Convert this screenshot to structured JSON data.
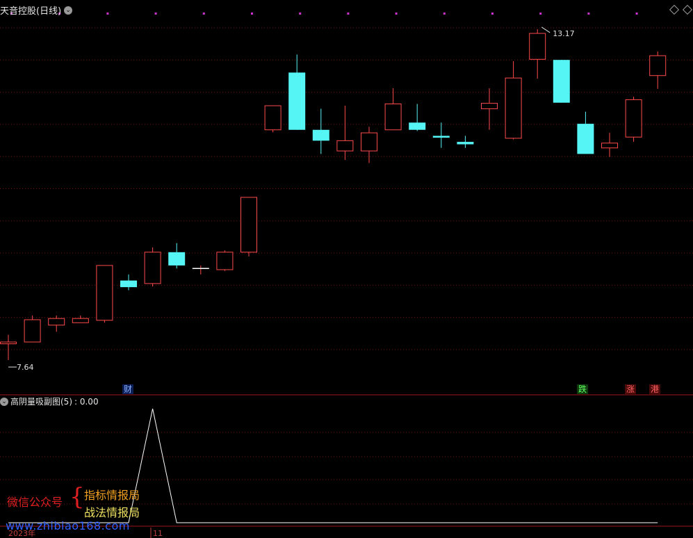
{
  "header": {
    "title": "天音控股(日线)",
    "menu_icon": "chevron-down-icon"
  },
  "subchart": {
    "title": "高阴量吸副图(5)",
    "value_text": ": 0.00"
  },
  "price_labels": {
    "high": "13.17",
    "low": "7.64"
  },
  "event_badges": [
    {
      "text": "财",
      "color": "#4a8aff"
    },
    {
      "text": "跌",
      "color": "#40d040"
    },
    {
      "text": "涨",
      "color": "#ff4040"
    },
    {
      "text": "港",
      "color": "#ff4040"
    }
  ],
  "time_axis": {
    "year_label": "2023年",
    "month_label": "11"
  },
  "watermark": {
    "left": "微信公众号",
    "right_1": "指标情报局",
    "right_2": "战法情报局",
    "url": "www.zhibiao168.com"
  },
  "colors": {
    "up": "#ff4a4a",
    "down": "#55f5f5",
    "grid": "#7a1010",
    "marker": "#cc33cc",
    "indicator": "#ffffff"
  },
  "chart_data": {
    "type": "candlestick",
    "price_range": [
      7.3,
      13.4
    ],
    "candles": [
      {
        "o": 7.95,
        "h": 8.1,
        "l": 7.68,
        "c": 7.98
      },
      {
        "o": 7.98,
        "h": 8.42,
        "l": 7.98,
        "c": 8.35
      },
      {
        "o": 8.26,
        "h": 8.42,
        "l": 8.15,
        "c": 8.37
      },
      {
        "o": 8.3,
        "h": 8.42,
        "l": 8.3,
        "c": 8.37
      },
      {
        "o": 8.34,
        "h": 9.25,
        "l": 8.3,
        "c": 9.25
      },
      {
        "o": 9.0,
        "h": 9.1,
        "l": 8.84,
        "c": 8.89
      },
      {
        "o": 8.95,
        "h": 9.55,
        "l": 8.9,
        "c": 9.47
      },
      {
        "o": 9.47,
        "h": 9.62,
        "l": 9.2,
        "c": 9.25
      },
      {
        "o": 9.2,
        "h": 9.25,
        "l": 9.1,
        "c": 9.2
      },
      {
        "o": 9.18,
        "h": 9.5,
        "l": 9.16,
        "c": 9.47
      },
      {
        "o": 9.47,
        "h": 10.38,
        "l": 9.4,
        "c": 10.38
      },
      {
        "o": 11.5,
        "h": 11.9,
        "l": 11.46,
        "c": 11.9
      },
      {
        "o": 12.45,
        "h": 12.75,
        "l": 11.5,
        "c": 11.5
      },
      {
        "o": 11.5,
        "h": 11.85,
        "l": 11.1,
        "c": 11.32
      },
      {
        "o": 11.15,
        "h": 11.9,
        "l": 11.0,
        "c": 11.32
      },
      {
        "o": 11.15,
        "h": 11.55,
        "l": 10.95,
        "c": 11.45
      },
      {
        "o": 11.5,
        "h": 12.19,
        "l": 11.5,
        "c": 11.93
      },
      {
        "o": 11.62,
        "h": 11.93,
        "l": 11.48,
        "c": 11.5
      },
      {
        "o": 11.4,
        "h": 11.62,
        "l": 11.2,
        "c": 11.37
      },
      {
        "o": 11.3,
        "h": 11.4,
        "l": 11.2,
        "c": 11.26
      },
      {
        "o": 11.85,
        "h": 12.19,
        "l": 11.5,
        "c": 11.94
      },
      {
        "o": 11.36,
        "h": 12.64,
        "l": 11.34,
        "c": 12.36
      },
      {
        "o": 12.67,
        "h": 13.17,
        "l": 12.35,
        "c": 13.1
      },
      {
        "o": 12.66,
        "h": 12.66,
        "l": 11.95,
        "c": 11.95
      },
      {
        "o": 11.6,
        "h": 11.8,
        "l": 11.1,
        "c": 11.1
      },
      {
        "o": 11.2,
        "h": 11.45,
        "l": 11.05,
        "c": 11.28
      },
      {
        "o": 11.38,
        "h": 12.05,
        "l": 11.3,
        "c": 12.0
      },
      {
        "o": 12.4,
        "h": 12.8,
        "l": 12.18,
        "c": 12.73
      }
    ],
    "indicator": {
      "name": "高阴量吸副图(5)",
      "values": [
        0,
        0,
        0,
        0,
        0,
        0,
        1,
        0,
        0,
        0,
        0,
        0,
        0,
        0,
        0,
        0,
        0,
        0,
        0,
        0,
        0,
        0,
        0,
        0,
        0,
        0,
        0,
        0
      ],
      "range": [
        0,
        1
      ]
    }
  }
}
